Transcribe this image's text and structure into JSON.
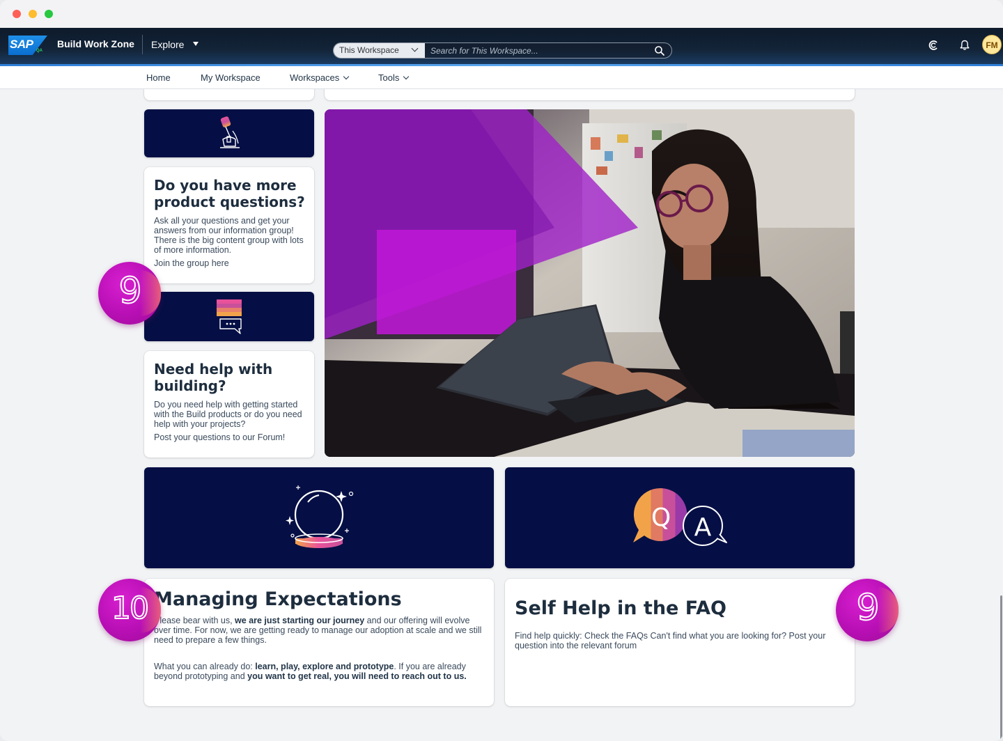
{
  "window": {
    "controls": [
      "close",
      "minimize",
      "maximize"
    ]
  },
  "shell": {
    "logo": "SAP",
    "logo_tag": "QA",
    "product": "Build Work Zone",
    "explore": "Explore",
    "search": {
      "scope": "This Workspace",
      "placeholder": "Search for This Workspace..."
    },
    "icons": [
      "joule-icon",
      "notification-bell-icon"
    ],
    "avatar_initials": "FM"
  },
  "nav": {
    "items": [
      {
        "label": "Home",
        "dropdown": false
      },
      {
        "label": "My Workspace",
        "dropdown": false
      },
      {
        "label": "Workspaces",
        "dropdown": true
      },
      {
        "label": "Tools",
        "dropdown": true
      }
    ]
  },
  "cards": {
    "product_questions": {
      "title": "Do you have more product questions?",
      "body": "Ask all your questions and get your answers from our information group! There is the big content group with lots of more information.",
      "link": "Join the group here",
      "icon": "microphone-icon"
    },
    "need_help": {
      "title": "Need help with building?",
      "body": "Do you need help with getting started with the Build products or do you need help with your projects?",
      "link": "Post your questions to our Forum!",
      "icon": "chat-bubble-icon"
    },
    "expectations": {
      "title": "Managing Expectations",
      "p1_a": "Please bear with us, ",
      "p1_b": "we are just starting our journey",
      "p1_c": " and our offering will evolve over time. For now, we are getting ready to manage our adoption at scale and we still need to prepare a few things.",
      "p2_a": "What you can already do: ",
      "p2_b": "learn, play, explore and prototype",
      "p2_c": ". If you are already beyond prototyping and ",
      "p2_d": "you want to get real, you will need to reach out to us.",
      "icon": "crystal-ball-icon"
    },
    "faq": {
      "title": "Self Help in the FAQ",
      "body": "Find help quickly:  Check the FAQs Can't find what you are looking for? Post your question into the relevant forum",
      "icon": "qa-bubbles-icon",
      "q": "Q",
      "a": "A"
    }
  },
  "badges": {
    "badge_1": "9",
    "badge_2": "10",
    "badge_3": "9"
  },
  "colors": {
    "shell": "#0d1a2b",
    "tile_navy": "#050f45",
    "badge": "#c214c0",
    "heading": "#1d2d3e"
  }
}
